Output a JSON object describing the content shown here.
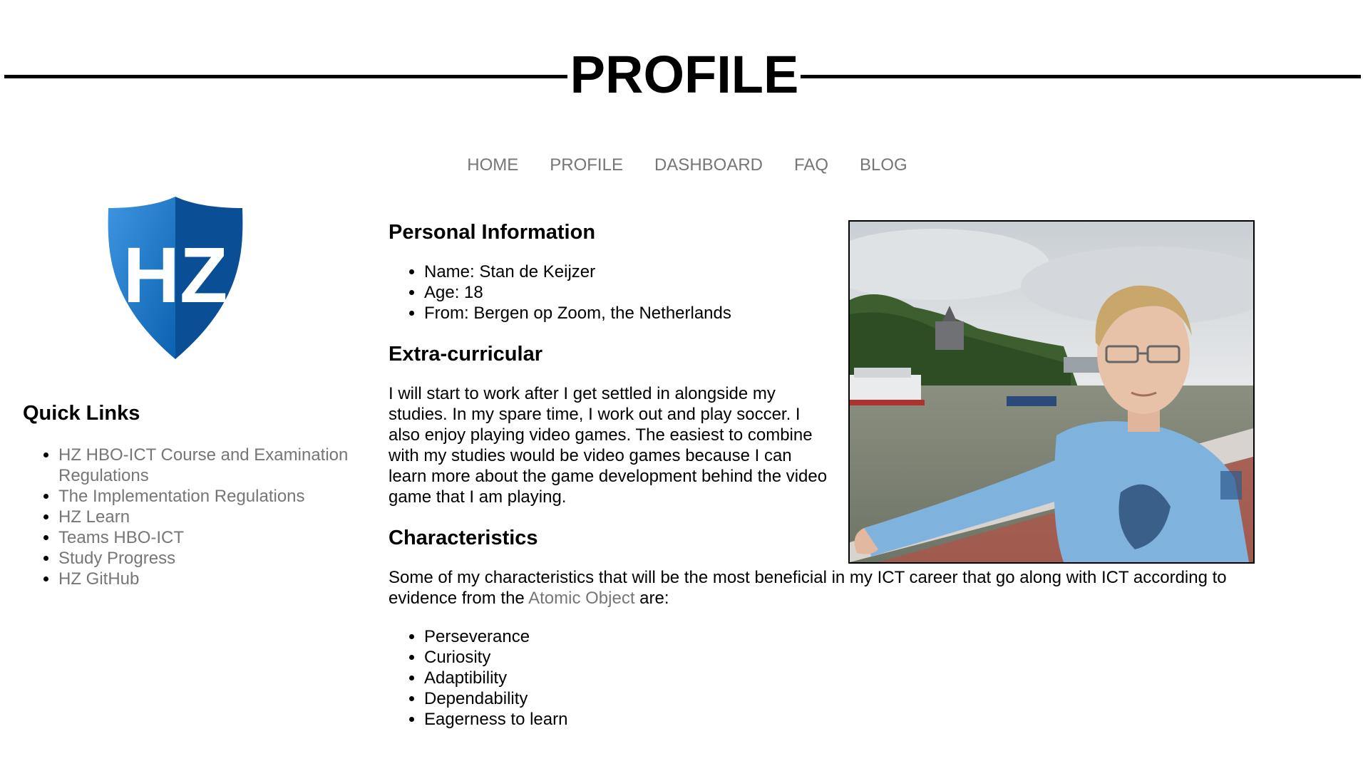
{
  "header": {
    "title": "PROFILE"
  },
  "nav": {
    "items": [
      {
        "label": "HOME"
      },
      {
        "label": "PROFILE"
      },
      {
        "label": "DASHBOARD"
      },
      {
        "label": "FAQ"
      },
      {
        "label": "BLOG"
      }
    ]
  },
  "sidebar": {
    "logo_text": "HZ",
    "quick_links_title": "Quick Links",
    "links": [
      {
        "label": "HZ HBO-ICT Course and Examination Regulations"
      },
      {
        "label": "The Implementation Regulations"
      },
      {
        "label": "HZ Learn"
      },
      {
        "label": "Teams HBO-ICT"
      },
      {
        "label": "Study Progress"
      },
      {
        "label": "HZ GitHub"
      }
    ]
  },
  "personal": {
    "title": "Personal Information",
    "items": [
      {
        "text": "Name: Stan de Keijzer"
      },
      {
        "text": "Age: 18"
      },
      {
        "text": "From: Bergen op Zoom, the Netherlands"
      }
    ]
  },
  "extra": {
    "title": "Extra-curricular",
    "text": "I will start to work after I get settled in alongside my studies. In my spare time, I work out and play soccer. I also enjoy playing video games. The easiest to combine with my studies would be video games because I can learn more about the game development behind the video game that I am playing."
  },
  "characteristics": {
    "title": "Characteristics",
    "intro_before": "Some of my characteristics that will be the most beneficial in my ICT career that go along with ICT according to evidence from the ",
    "link": "Atomic Object",
    "intro_after": " are:",
    "items": [
      {
        "text": "Perseverance"
      },
      {
        "text": "Curiosity"
      },
      {
        "text": "Adaptibility"
      },
      {
        "text": "Dependability"
      },
      {
        "text": "Eagerness to learn"
      }
    ]
  },
  "colors": {
    "link": "#767676",
    "text": "#000000",
    "logo_blue": "#0a62b0",
    "logo_dark": "#0a4f96"
  }
}
